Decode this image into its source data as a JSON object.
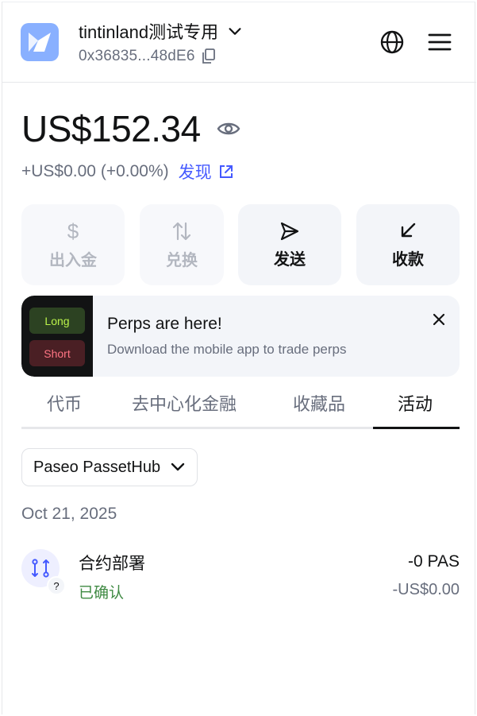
{
  "header": {
    "account_name": "tintinland测试专用",
    "account_address": "0x36835...48dE6"
  },
  "balance": {
    "amount": "US$152.34",
    "change": "+US$0.00 (+0.00%)",
    "discover_label": "发现"
  },
  "actions": {
    "buy_sell": "出入金",
    "swap": "兑换",
    "send": "发送",
    "receive": "收款"
  },
  "banner": {
    "long_label": "Long",
    "short_label": "Short",
    "title": "Perps are here!",
    "subtitle": "Download the mobile app to trade perps"
  },
  "tabs": [
    "代币",
    "去中心化金融",
    "收藏品",
    "活动"
  ],
  "active_tab": "活动",
  "network_filter": "Paseo PassetHub",
  "activity": {
    "date": "Oct 21, 2025",
    "items": [
      {
        "title": "合约部署",
        "status": "已确认",
        "amount": "-0 PAS",
        "fiat": "-US$0.00",
        "badge": "?"
      }
    ]
  },
  "colors": {
    "accent": "#4459ff",
    "logo_bg": "#89b0ff",
    "success": "#3f8a43",
    "muted": "#686e7d"
  }
}
